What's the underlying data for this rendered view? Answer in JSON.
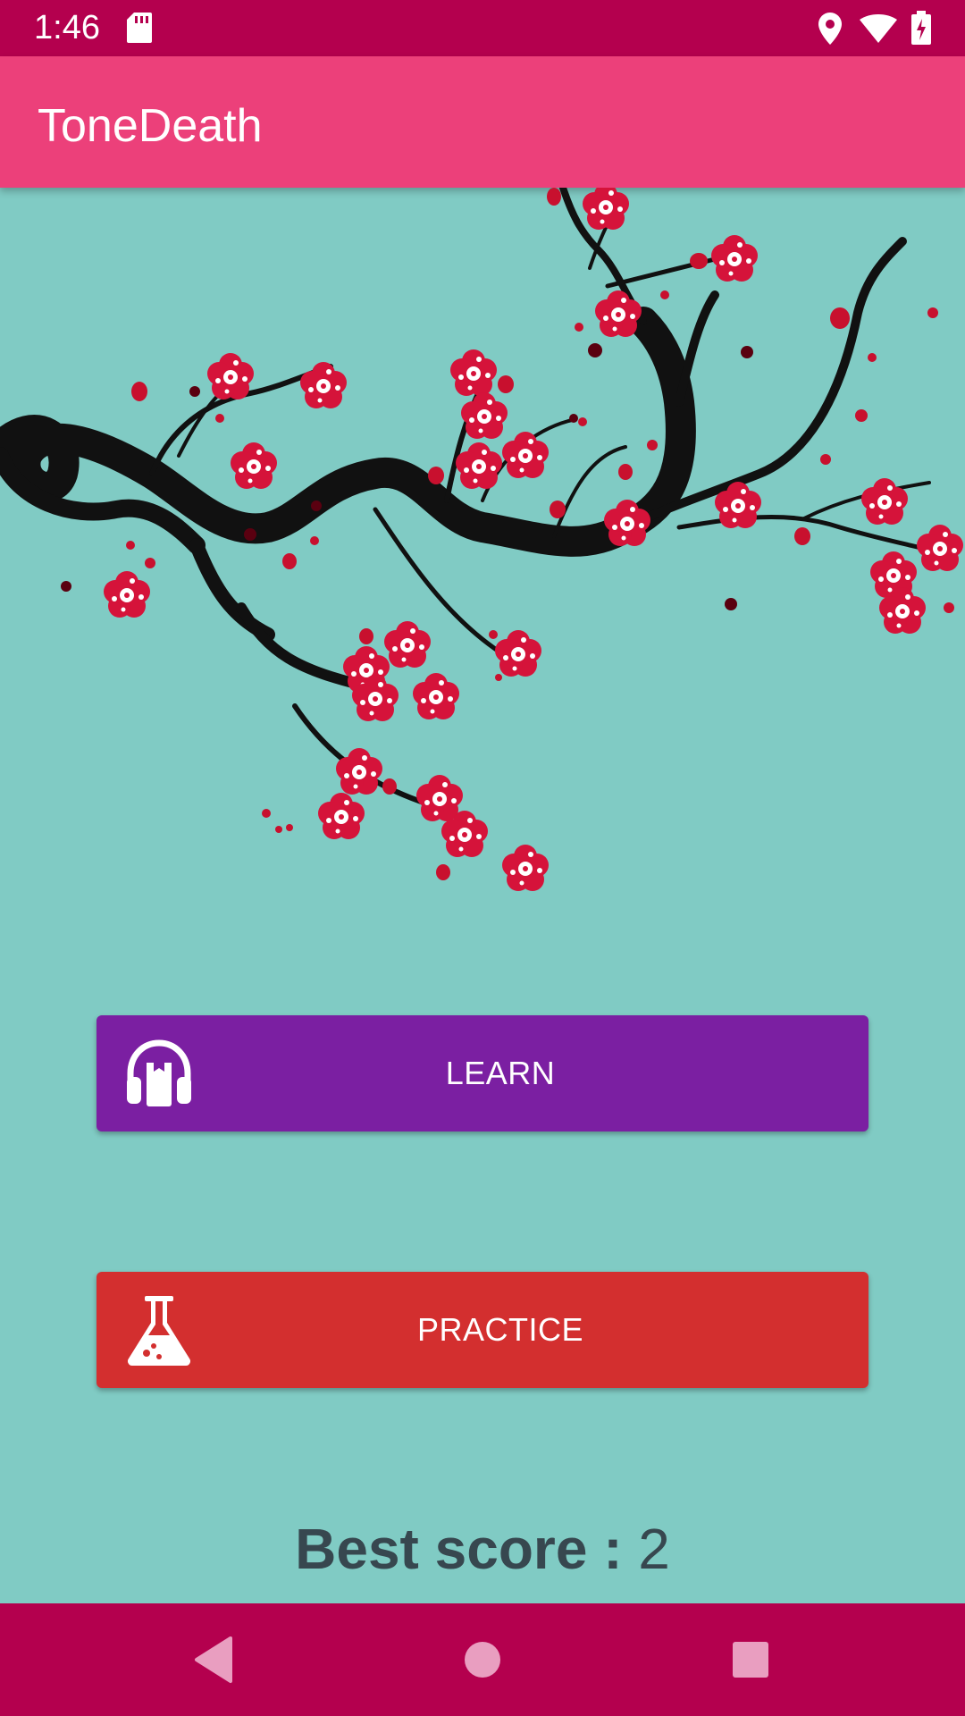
{
  "status_bar": {
    "time": "1:46",
    "icons": [
      "sd-card-icon",
      "location-icon",
      "wifi-icon",
      "battery-charging-icon"
    ]
  },
  "app_bar": {
    "title": "ToneDeath"
  },
  "hero": {
    "image": "cherry-blossom-branch"
  },
  "buttons": {
    "learn_label": "LEARN",
    "learn_icon": "headphones-icon",
    "practice_label": "PRACTICE",
    "practice_icon": "flask-icon"
  },
  "score": {
    "label": "Best score :",
    "value": "2"
  },
  "nav": {
    "icons": [
      "back-icon",
      "home-icon",
      "recents-icon"
    ]
  },
  "colors": {
    "status_bar": "#b4004e",
    "app_bar": "#ec407a",
    "background": "#80cbc4",
    "learn_button": "#7b1fa2",
    "practice_button": "#d32f2f",
    "score_text": "#37474f"
  }
}
